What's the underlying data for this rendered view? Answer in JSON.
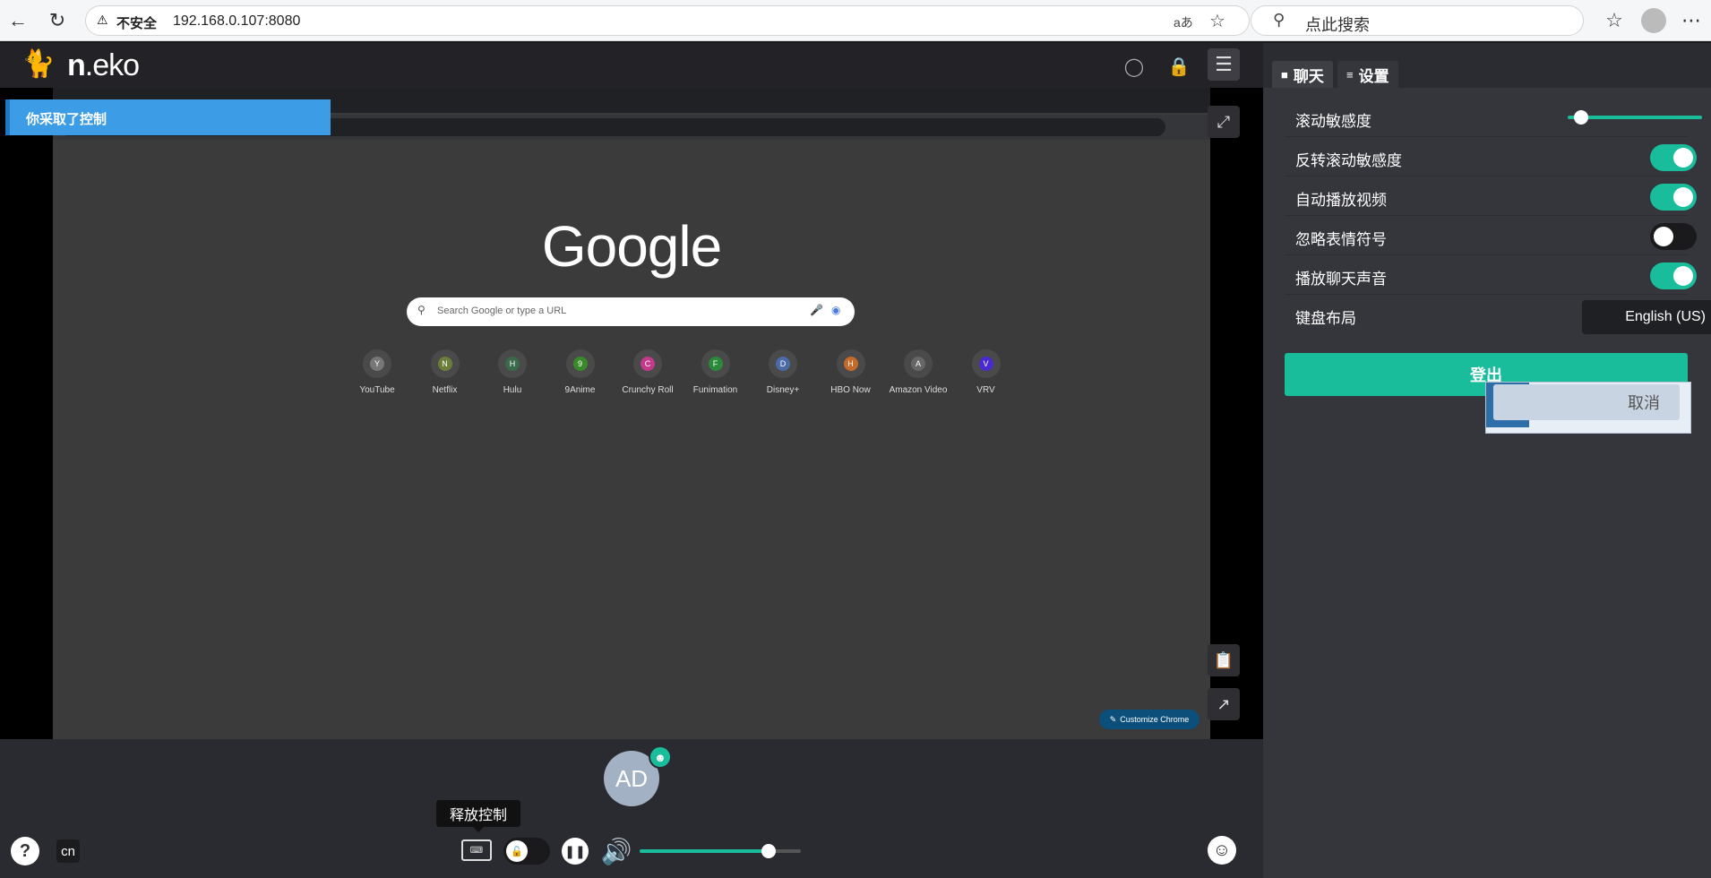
{
  "browser": {
    "insecure_label": "不安全",
    "url": "192.168.0.107:8080",
    "search_placeholder": "点此搜索"
  },
  "app": {
    "logo_bold": "n",
    "logo_rest": ".eko",
    "notice": "你采取了控制"
  },
  "remote": {
    "google_logo": "Google",
    "search_placeholder": "Search Google or type a URL",
    "customize_label": "Customize Chrome",
    "shortcuts": [
      {
        "label": "YouTube",
        "letter": "Y",
        "color": "#777777"
      },
      {
        "label": "Netflix",
        "letter": "N",
        "color": "#6b7f3a"
      },
      {
        "label": "Hulu",
        "letter": "H",
        "color": "#3a6a4a"
      },
      {
        "label": "9Anime",
        "letter": "9",
        "color": "#3a8a2a"
      },
      {
        "label": "Crunchy Roll",
        "letter": "C",
        "color": "#c43a8a"
      },
      {
        "label": "Funimation",
        "letter": "F",
        "color": "#2a8a3a"
      },
      {
        "label": "Disney+",
        "letter": "D",
        "color": "#4a6aa8"
      },
      {
        "label": "HBO Now",
        "letter": "H",
        "color": "#c46a2a"
      },
      {
        "label": "Amazon Video",
        "letter": "A",
        "color": "#666666"
      },
      {
        "label": "VRV",
        "letter": "V",
        "color": "#4a2ad0"
      }
    ]
  },
  "bottom": {
    "avatar_initials": "AD",
    "tooltip": "释放控制",
    "help": "?",
    "lang": "cn",
    "volume": 0.8
  },
  "panel": {
    "tabs": [
      {
        "label": "聊天",
        "icon": "chat-icon"
      },
      {
        "label": "设置",
        "icon": "sliders-icon"
      }
    ],
    "settings": {
      "scroll_sensitivity": {
        "label": "滚动敏感度",
        "value": 0.1
      },
      "invert_scroll": {
        "label": "反转滚动敏感度",
        "on": true
      },
      "autoplay": {
        "label": "自动播放视频",
        "on": true
      },
      "ignore_emotes": {
        "label": "忽略表情符号",
        "on": false
      },
      "chat_sound": {
        "label": "播放聊天声音",
        "on": true
      },
      "keyboard_layout": {
        "label": "键盘布局",
        "value": "English (US)"
      }
    },
    "logout": "登出",
    "cancel": "取消"
  },
  "colors": {
    "accent": "#19bd9c",
    "notice": "#3d9ce6"
  }
}
